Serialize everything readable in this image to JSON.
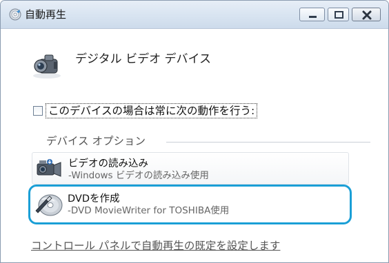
{
  "window": {
    "title": "自動再生",
    "icon": "autoplay-disc-icon",
    "controls": [
      "minimize-icon",
      "maximize-icon",
      "close-icon"
    ]
  },
  "device": {
    "icon": "camcorder-icon",
    "name": "デジタル ビデオ デバイス"
  },
  "always_checkbox": {
    "label": "このデバイスの場合は常に次の動作を行う:",
    "checked": false
  },
  "options_group": {
    "label": "デバイス オプション",
    "items": [
      {
        "icon": "video-camera-icon",
        "title": "ビデオの読み込み",
        "subtitle": "-Windows ビデオの読み込み使用"
      },
      {
        "icon": "dvd-burn-icon",
        "title": "DVDを作成",
        "subtitle": "-DVD MovieWriter for TOSHIBA使用"
      }
    ]
  },
  "footer": {
    "link": "コントロール パネルで自動再生の既定を設定します"
  },
  "colors": {
    "highlight": "#1a9fd6",
    "link": "#555555"
  }
}
